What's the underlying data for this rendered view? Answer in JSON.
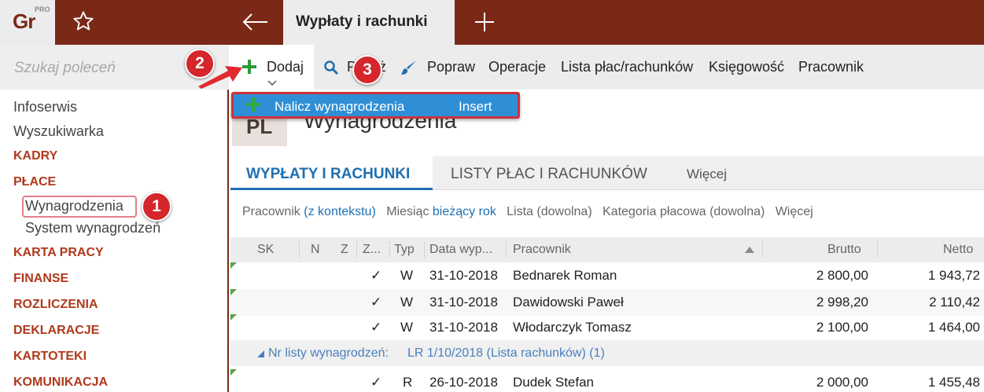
{
  "app": {
    "logo_text": "Gr",
    "logo_badge": "PRO",
    "tab_title": "Wypłaty i rachunki"
  },
  "sidebar": {
    "search_placeholder": "Szukaj poleceń",
    "items": [
      {
        "label": "Infoserwis"
      },
      {
        "label": "Wyszukiwarka"
      },
      {
        "label": "KADRY"
      },
      {
        "label": "PŁACE"
      },
      {
        "label": "Wynagrodzenia"
      },
      {
        "label": "System wynagrodzeń"
      },
      {
        "label": "KARTA PRACY"
      },
      {
        "label": "FINANSE"
      },
      {
        "label": "ROZLICZENIA"
      },
      {
        "label": "DEKLARACJE"
      },
      {
        "label": "KARTOTEKI"
      },
      {
        "label": "KOMUNIKACJA"
      }
    ]
  },
  "callouts": {
    "c1": "1",
    "c2": "2",
    "c3": "3"
  },
  "toolbar": {
    "add": "Dodaj",
    "show": "Pokaż",
    "fix": "Popraw",
    "operations": "Operacje",
    "payroll_lists": "Lista płac/rachunków",
    "accounting": "Księgowość",
    "employee": "Pracownik"
  },
  "dropdown": {
    "label": "Nalicz wynagrodzenia",
    "shortcut": "Insert"
  },
  "page": {
    "badge": "PL",
    "title": "Wynagrodzenia"
  },
  "tabs": [
    "WYPŁATY I RACHUNKI",
    "LISTY PŁAC I RACHUNKÓW",
    "Więcej"
  ],
  "filters": {
    "employee_label": "Pracownik",
    "employee_value": "(z kontekstu)",
    "month_label": "Miesiąc",
    "month_value": "bieżący rok",
    "list_label": "Lista (dowolna)",
    "category_label": "Kategoria płacowa (dowolna)",
    "more_label": "Więcej"
  },
  "table": {
    "columns": [
      "SK",
      "N",
      "Z",
      "Z...",
      "Typ",
      "Data wyp...",
      "Pracownik",
      "Brutto",
      "Netto"
    ],
    "rows": [
      {
        "check": "✓",
        "type": "W",
        "date": "31-10-2018",
        "name": "Bednarek Roman",
        "gross": "2 800,00",
        "net": "1 943,72"
      },
      {
        "check": "✓",
        "type": "W",
        "date": "31-10-2018",
        "name": "Dawidowski Paweł",
        "gross": "2 998,20",
        "net": "2 110,42"
      },
      {
        "check": "✓",
        "type": "W",
        "date": "31-10-2018",
        "name": "Włodarczyk Tomasz",
        "gross": "2 100,00",
        "net": "1 464,00"
      }
    ],
    "group": {
      "label": "Nr listy wynagrodzeń:",
      "value": "LR 1/10/2018 (Lista rachunków) (1)"
    },
    "group_rows": [
      {
        "check": "✓",
        "type": "R",
        "date": "26-10-2018",
        "name": "Dudek Stefan",
        "gross": "2 000,00",
        "net": "1 455,48"
      }
    ]
  },
  "colors": {
    "brand": "#7a2917",
    "accent_blue": "#1f6fb2",
    "callout_red": "#d4262b",
    "add_green": "#2e9a3b",
    "menu_blue": "#2f8fd6"
  },
  "icons": {
    "star": "star-icon",
    "back": "back-arrow-icon",
    "new_tab": "plus-icon",
    "add": "plus-green-icon",
    "show": "magnifier-icon",
    "fix": "brush-icon",
    "chevron": "chevron-down-icon",
    "sort": "sort-asc-icon"
  }
}
